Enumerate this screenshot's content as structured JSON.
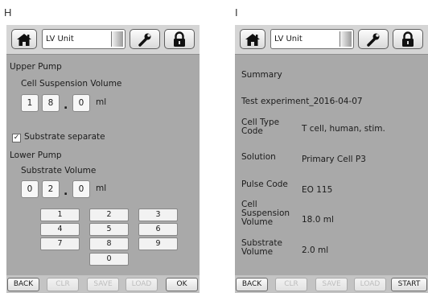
{
  "panels": {
    "left": {
      "letter": "H",
      "unit_name": "LV Unit",
      "upper_pump": {
        "title": "Upper Pump",
        "subtitle": "Cell Suspension Volume",
        "digits": [
          "1",
          "8",
          "0"
        ],
        "separator": ".",
        "unit": "ml"
      },
      "substrate_checkbox": {
        "mark": "✓",
        "label": "Substrate separate",
        "checked": true
      },
      "lower_pump": {
        "title": "Lower Pump",
        "subtitle": "Substrate Volume",
        "digits": [
          "0",
          "2",
          "0"
        ],
        "separator": ".",
        "unit": "ml"
      },
      "keypad": [
        "1",
        "2",
        "3",
        "4",
        "5",
        "6",
        "7",
        "8",
        "9",
        "0"
      ],
      "bottom_buttons": {
        "back": "BACK",
        "clr": "CLR",
        "save": "SAVE",
        "load": "LOAD",
        "ok": "OK"
      }
    },
    "right": {
      "letter": "I",
      "unit_name": "LV Unit",
      "summary_title": "Summary",
      "experiment_name": "Test experiment_2016-04-07",
      "rows": [
        {
          "label_lines": [
            "Cell Type",
            "Code"
          ],
          "value": "T cell, human, stim."
        },
        {
          "label_lines": [
            "Solution"
          ],
          "value": "Primary Cell P3"
        },
        {
          "label_lines": [
            "Pulse Code"
          ],
          "value": "EO  115"
        },
        {
          "label_lines": [
            "Cell",
            "Suspension",
            "Volume"
          ],
          "value": "18.0 ml"
        },
        {
          "label_lines": [
            "Substrate",
            "Volume"
          ],
          "value": "2.0 ml"
        }
      ],
      "bottom_buttons": {
        "back": "BACK",
        "clr": "CLR",
        "save": "SAVE",
        "load": "LOAD",
        "start": "START"
      }
    }
  },
  "icons": {
    "home": "home-icon",
    "wrench": "wrench-icon",
    "lock": "lock-icon",
    "dropdown": "dropdown-knob-icon"
  },
  "colors": {
    "screen_bg": "#a9a9a9",
    "topbar_bg": "#d5d5d5",
    "field_bg": "#ffffff",
    "disabled_text": "#bdbdbd"
  }
}
